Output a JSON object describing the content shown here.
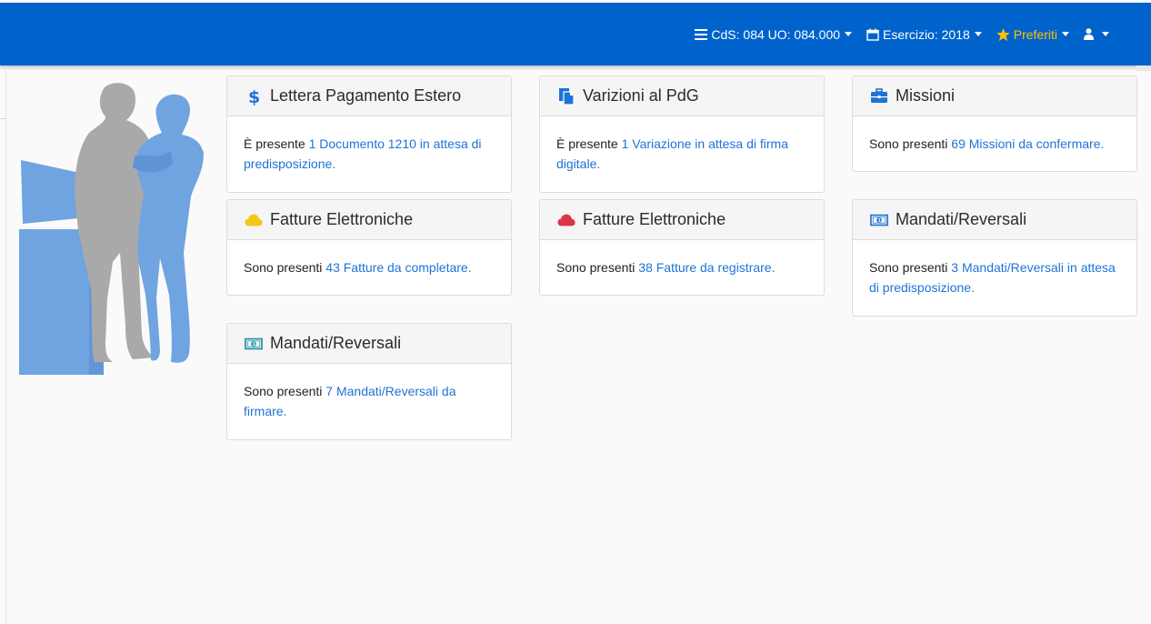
{
  "nav": {
    "cds_label": "CdS: 084 UO: 084.000",
    "esercizio_label": "Esercizio: 2018",
    "preferiti_label": "Preferiti"
  },
  "colors": {
    "navbar": "#0063cc",
    "link": "#1e73d6",
    "star": "#ffc107",
    "cloud_yellow": "#f5c518",
    "cloud_red": "#dc3545"
  },
  "cards": [
    {
      "icon": "dollar-icon",
      "title": "Lettera Pagamento Estero",
      "text": "È presente ",
      "link": "1 Documento 1210 in attesa di predisposizione."
    },
    {
      "icon": "documents-icon",
      "title": "Varizioni al PdG",
      "text": "È presente ",
      "link": "1 Variazione in attesa di firma digitale."
    },
    {
      "icon": "briefcase-icon",
      "title": "Missioni",
      "text": "Sono presenti ",
      "link": "69 Missioni da confermare."
    },
    {
      "icon": "cloud-yellow-icon",
      "title": "Fatture Elettroniche",
      "text": "Sono presenti ",
      "link": "43 Fatture da completare."
    },
    {
      "icon": "cloud-red-icon",
      "title": "Fatture Elettroniche",
      "text": "Sono presenti ",
      "link": "38 Fatture da registrare."
    },
    {
      "icon": "banknote-icon",
      "title": "Mandati/Reversali",
      "text": "Sono presenti ",
      "link": "3 Mandati/Reversali in attesa di predisposizione."
    },
    {
      "icon": "banknote-icon",
      "title": "Mandati/Reversali",
      "text": "Sono presenti ",
      "link": "7 Mandati/Reversali da firmare."
    }
  ]
}
